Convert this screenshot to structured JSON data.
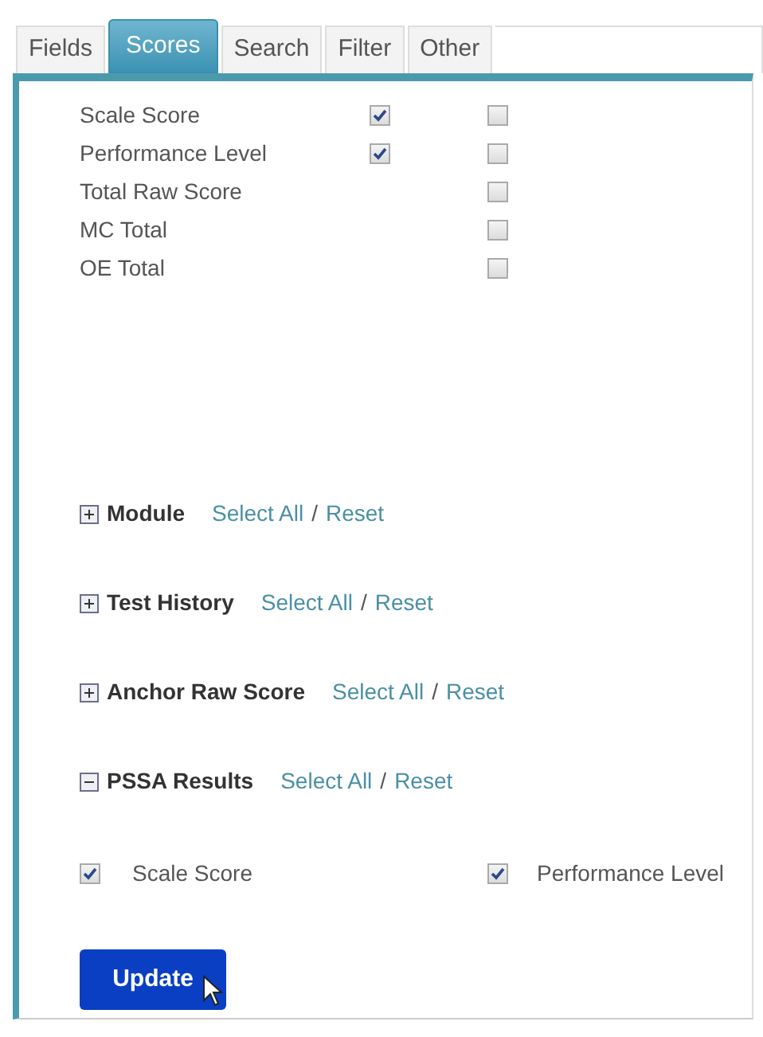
{
  "tabs": [
    {
      "label": "Fields",
      "selected": false
    },
    {
      "label": "Scores",
      "selected": true
    },
    {
      "label": "Search",
      "selected": false
    },
    {
      "label": "Filter",
      "selected": false
    },
    {
      "label": "Other",
      "selected": false
    }
  ],
  "score_rows": [
    {
      "label": "Scale Score",
      "checkbox_1": {
        "checked": true
      },
      "checkbox_2": {
        "checked": false
      }
    },
    {
      "label": "Performance Level",
      "checkbox_1": {
        "checked": true
      },
      "checkbox_2": {
        "checked": false
      }
    },
    {
      "label": "Total Raw Score",
      "checkbox_2": {
        "checked": false
      }
    },
    {
      "label": "MC Total",
      "checkbox_2": {
        "checked": false
      }
    },
    {
      "label": "OE Total",
      "checkbox_2": {
        "checked": false
      }
    }
  ],
  "sections": [
    {
      "title": "Module",
      "expanded": false,
      "select_all": "Select All",
      "separator": "/",
      "reset": "Reset"
    },
    {
      "title": "Test History",
      "expanded": false,
      "select_all": "Select All",
      "separator": "/",
      "reset": "Reset"
    },
    {
      "title": "Anchor Raw Score",
      "expanded": false,
      "select_all": "Select All",
      "separator": "/",
      "reset": "Reset"
    },
    {
      "title": "PSSA Results",
      "expanded": true,
      "select_all": "Select All",
      "separator": "/",
      "reset": "Reset",
      "items": [
        {
          "label": "Scale Score",
          "checked": true
        },
        {
          "label": "Performance Level",
          "checked": true
        }
      ]
    }
  ],
  "update_button": "Update"
}
